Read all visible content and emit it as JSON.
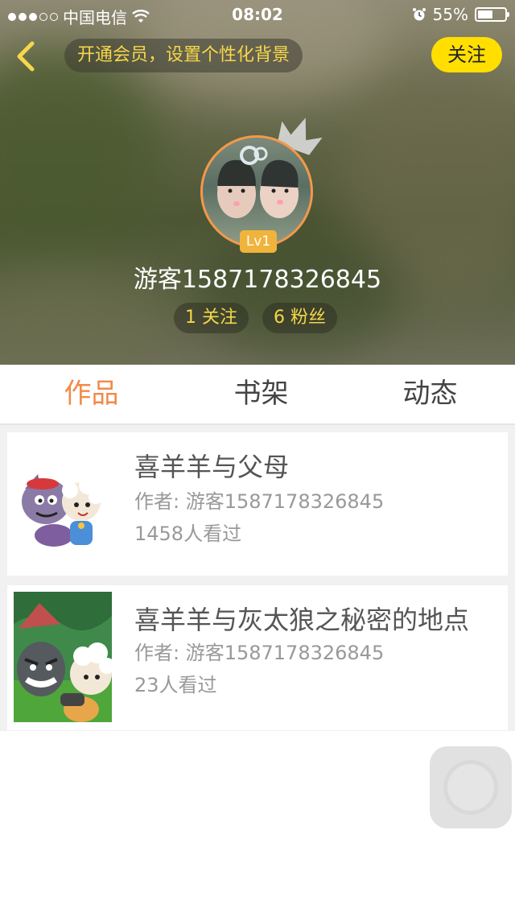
{
  "status_bar": {
    "carrier": "中国电信",
    "time": "08:02",
    "battery": "55%",
    "battery_level": 0.55
  },
  "nav": {
    "vip_banner": "开通会员，设置个性化背景",
    "follow_label": "关注"
  },
  "profile": {
    "level": "Lv1",
    "username": "游客1587178326845",
    "following": "1 关注",
    "fans": "6 粉丝"
  },
  "tabs": [
    {
      "label": "作品",
      "active": true
    },
    {
      "label": "书架",
      "active": false
    },
    {
      "label": "动态",
      "active": false
    }
  ],
  "works": [
    {
      "title": "喜羊羊与父母",
      "author": "作者: 游客1587178326845",
      "views": "1458人看过"
    },
    {
      "title": "喜羊羊与灰太狼之秘密的地点",
      "author": "作者: 游客1587178326845",
      "views": "23人看过"
    }
  ],
  "colors": {
    "accent_orange": "#f28a4a",
    "yellow": "#ffde00",
    "gold_text": "#f5d74a"
  }
}
